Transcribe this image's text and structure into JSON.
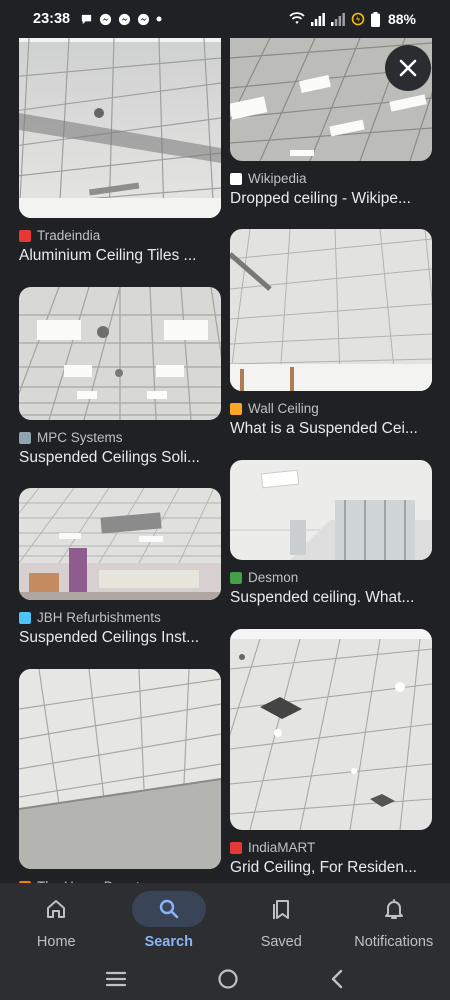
{
  "status": {
    "time": "23:38",
    "battery": "88%"
  },
  "results": {
    "left": [
      {
        "source": "Tradeindia",
        "title": "Aluminium Ceiling Tiles ...",
        "favicon_color": "#e53935"
      },
      {
        "source": "MPC Systems",
        "title": "Suspended Ceilings Soli...",
        "favicon_color": "#90a4ae"
      },
      {
        "source": "JBH Refurbishments",
        "title": "Suspended Ceilings Inst...",
        "favicon_color": "#4fc3f7"
      },
      {
        "source": "The Home Depot",
        "title": "",
        "favicon_color": "#f57c00"
      }
    ],
    "right": [
      {
        "source": "Wikipedia",
        "title": "Dropped ceiling - Wikipe...",
        "favicon_color": "#ffffff"
      },
      {
        "source": "Wall Ceiling",
        "title": "What is a Suspended Cei...",
        "favicon_color": "#f9a825"
      },
      {
        "source": "Desmon",
        "title": "Suspended ceiling. What...",
        "favicon_color": "#43a047"
      },
      {
        "source": "IndiaMART",
        "title": "Grid Ceiling, For Residen...",
        "favicon_color": "#e53935"
      }
    ]
  },
  "nav": {
    "home": "Home",
    "search": "Search",
    "saved": "Saved",
    "notifications": "Notifications"
  },
  "colors": {
    "accent": "#8ab4f8",
    "background": "#202124",
    "nav_bg": "#2d2e31"
  }
}
